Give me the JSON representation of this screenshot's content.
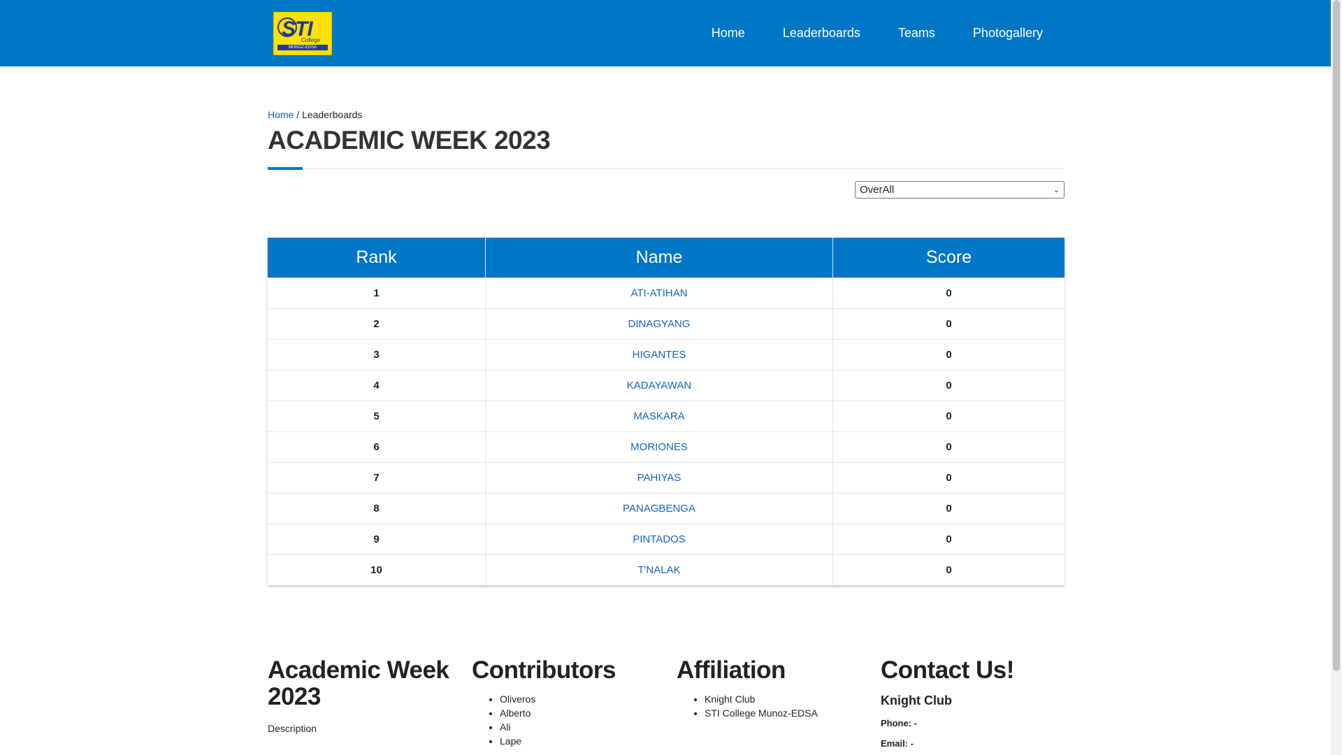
{
  "nav": {
    "logo": {
      "main": "STI",
      "sub": "College",
      "band": "MUNOZ-EDSA"
    },
    "links": [
      "Home",
      "Leaderboards",
      "Teams",
      "Photogallery"
    ]
  },
  "breadcrumb": {
    "home": "Home",
    "sep": "/",
    "current": "Leaderboards"
  },
  "page_title": "ACADEMIC WEEK 2023",
  "filter": {
    "selected": "OverAll"
  },
  "table": {
    "headers": [
      "Rank",
      "Name",
      "Score"
    ],
    "rows": [
      {
        "rank": "1",
        "name": "ATI-ATIHAN",
        "score": "0"
      },
      {
        "rank": "2",
        "name": "DINAGYANG",
        "score": "0"
      },
      {
        "rank": "3",
        "name": "HIGANTES",
        "score": "0"
      },
      {
        "rank": "4",
        "name": "KADAYAWAN",
        "score": "0"
      },
      {
        "rank": "5",
        "name": "MASKARA",
        "score": "0"
      },
      {
        "rank": "6",
        "name": "MORIONES",
        "score": "0"
      },
      {
        "rank": "7",
        "name": "PAHIYAS",
        "score": "0"
      },
      {
        "rank": "8",
        "name": "PANAGBENGA",
        "score": "0"
      },
      {
        "rank": "9",
        "name": "PINTADOS",
        "score": "0"
      },
      {
        "rank": "10",
        "name": "T'NALAK",
        "score": "0"
      }
    ]
  },
  "footer": {
    "about": {
      "title_line1": "Academic Week",
      "title_line2": "2023",
      "desc": "Description"
    },
    "contributors": {
      "title": "Contributors",
      "items": [
        "Oliveros",
        "Alberto",
        "Ali",
        "Lape"
      ]
    },
    "affiliation": {
      "title": "Affiliation",
      "items": [
        "Knight Club",
        "STI College Munoz-EDSA"
      ]
    },
    "contact": {
      "title": "Contact Us!",
      "org": "Knight Club",
      "phone": "Phone: -",
      "email": "Email: -"
    }
  },
  "colors": {
    "primary": "#0076c9",
    "logo_yellow": "#ffe000",
    "link": "#1565c0"
  }
}
